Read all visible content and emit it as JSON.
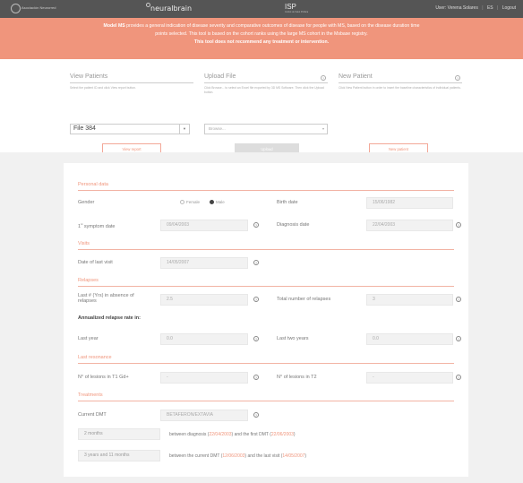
{
  "topbar": {
    "left_logo": "Asociación Neurorred",
    "brand": "neuralbrain",
    "center_logo": "ISP",
    "center_sub": "Institut de Salut Pública",
    "user": "User: Verena Solares",
    "language": "ES",
    "logout": "Logout"
  },
  "banner": {
    "line1_bold": "Model MS",
    "line1": " provides a general indication of disease severity and comparative outcomes of disease for people with MS, based on the disease duration time",
    "line2": "points selected. This tool is based on the cohort ranks using the large MS cohort in the Msbase registry.",
    "line3": "This tool does not recommend any treatment or intervention."
  },
  "view_patients": {
    "title": "View Patients",
    "desc": "Select the patient ID and click View report button.",
    "selected": "File 384",
    "button": "View report"
  },
  "upload_file": {
    "title": "Upload File",
    "desc": "Click Browse... to select an Excel file exported by 3D MS Software. Then click the Upload button.",
    "placeholder": "Browse...",
    "button": "Upload"
  },
  "new_patient": {
    "title": "New Patient",
    "desc": "Click New Patient button in order to insert the baseline characteristics of individual patients.",
    "button": "New patient"
  },
  "form": {
    "personal_data": {
      "section": "Personal data",
      "gender_label": "Gender",
      "female": "Female",
      "male": "Male",
      "birth_label": "Birth date",
      "birth_value": "15/06/1982",
      "symptom_label_pre": "1",
      "symptom_label_sup": "st",
      "symptom_label_post": " symptom date",
      "symptom_value": "09/04/2003",
      "diagnosis_label": "Diagnosis date",
      "diagnosis_value": "22/04/2003"
    },
    "visits": {
      "section": "Visits",
      "last_visit_label": "Date of last visit",
      "last_visit_value": "14/05/2007"
    },
    "relapses": {
      "section": "Relapses",
      "years_absence_label": "Last # (Yrs) in absence of relapses",
      "years_absence_value": "2.5",
      "total_label": "Total number of relapses",
      "total_value": "3",
      "annualized_label": "Annualized relapse rate in:",
      "last_year_label": "Last year",
      "last_year_value": "0.0",
      "last_two_label": "Last two years",
      "last_two_value": "0.0"
    },
    "lesions": {
      "section": "Last resonance",
      "t1_label": "N° of lesions in T1 Gd+",
      "t1_value": "-",
      "t2_label": "N° of lesions in T2",
      "t2_value": "-"
    },
    "treatments": {
      "section": "Treatments",
      "dmt_label": "Current DMT",
      "dmt_value": "BETAFERON/EXTAVIA",
      "dur1_value": "2 months",
      "dur1_pre": "between diagnosis (",
      "dur1_date1": "22/04/2003",
      "dur1_mid": ") and the first DMT (",
      "dur1_date2": "22/06/2003",
      "dur1_post": ")",
      "dur2_value": "3 years and 11 months",
      "dur2_pre": "between the current DMT (",
      "dur2_date1": "12/06/2003",
      "dur2_mid": ") and the last visit (",
      "dur2_date2": "14/05/2007",
      "dur2_post": ")"
    }
  },
  "colors": {
    "accent": "#f0957c",
    "topbar": "#555555",
    "page_grey": "#f1f1f1"
  }
}
